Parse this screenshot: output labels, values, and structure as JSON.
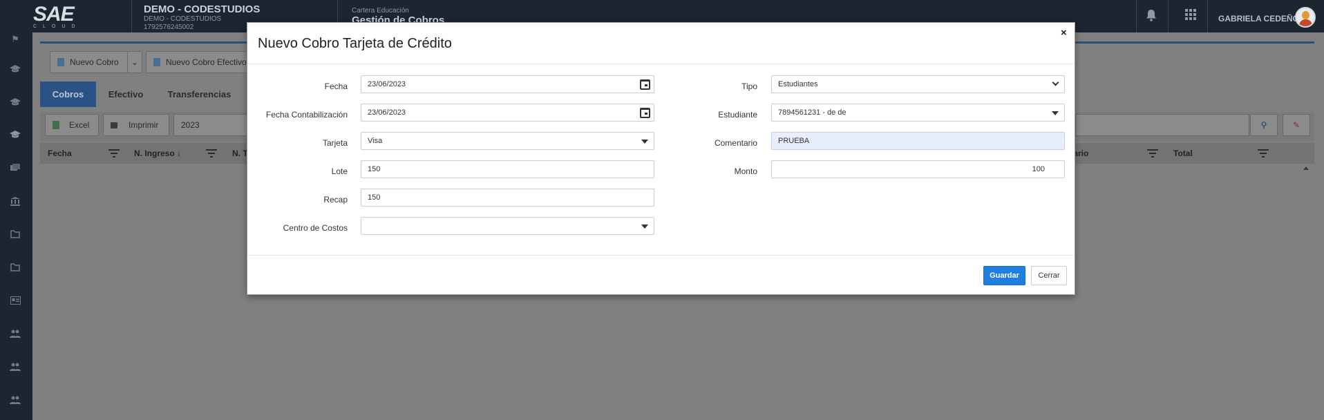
{
  "header": {
    "logo_text": "SAE",
    "logo_sub": "CLOUD",
    "company_name": "DEMO - CODESTUDIOS",
    "company_sub": "DEMO - CODESTUDIOS",
    "company_ruc": "1792576245002",
    "module_sub": "Cartera Educación",
    "module_title": "Gestión de Cobros",
    "user_name": "GABRIELA CEDEÑO"
  },
  "page": {
    "buttons": {
      "nuevo_cobro": "Nuevo Cobro",
      "nuevo_cobro_efectivo": "Nuevo Cobro Efectivo",
      "excel": "Excel",
      "imprimir": "Imprimir"
    },
    "tabs": [
      {
        "label": "Cobros"
      },
      {
        "label": "Efectivo"
      },
      {
        "label": "Transferencias"
      }
    ],
    "year_filter": "2023",
    "grid_headers": {
      "fecha": "Fecha",
      "n_ingreso": "N. Ingreso ↓",
      "n_t": "N. T",
      "comentario": "ntario",
      "total": "Total"
    }
  },
  "modal": {
    "title": "Nuevo Cobro Tarjeta de Crédito",
    "close": "×",
    "left": {
      "fecha_label": "Fecha",
      "fecha_value": "23/06/2023",
      "fecha_contab_label": "Fecha Contabilización",
      "fecha_contab_value": "23/06/2023",
      "tarjeta_label": "Tarjeta",
      "tarjeta_value": "Visa",
      "lote_label": "Lote",
      "lote_value": "150",
      "recap_label": "Recap",
      "recap_value": "150",
      "centro_label": "Centro de Costos",
      "centro_value": ""
    },
    "right": {
      "tipo_label": "Tipo",
      "tipo_value": "Estudiantes",
      "estudiante_label": "Estudiante",
      "estudiante_value": "7894561231 - de de",
      "comentario_label": "Comentario",
      "comentario_value": "PRUEBA",
      "monto_label": "Monto",
      "monto_value": "100"
    },
    "buttons": {
      "guardar": "Guardar",
      "cerrar": "Cerrar"
    }
  },
  "colors": {
    "header_bg": "#1c2530",
    "primary": "#1f7fe0",
    "tab_active": "#2a5285",
    "highlight_field": "#e8eefb"
  },
  "icons": {
    "sidebar": [
      "flag-icon",
      "graduation-cap-icon",
      "graduation-cap-icon",
      "graduation-cap-icon",
      "books-icon",
      "bank-icon",
      "folder-open-icon",
      "folder-open-icon",
      "id-card-icon",
      "users-icon",
      "users-icon",
      "users-icon"
    ],
    "header": [
      "bell-icon",
      "apps-grid-icon"
    ]
  }
}
